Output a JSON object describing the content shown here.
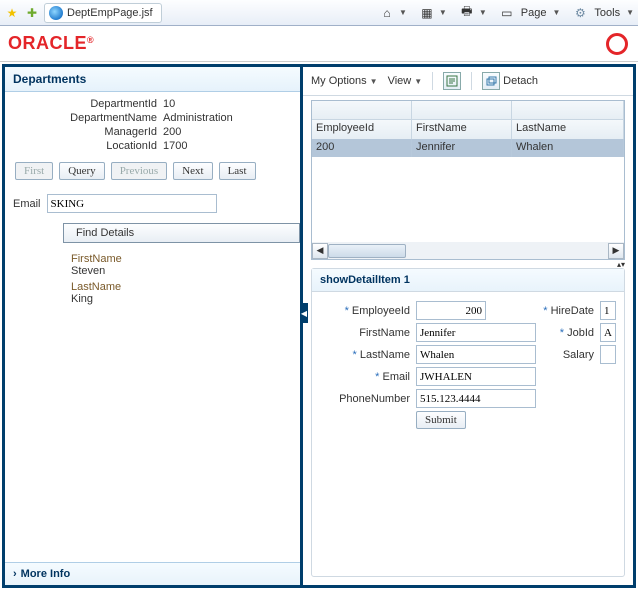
{
  "browser": {
    "star": "★",
    "addstar": "✚",
    "tabIcon": "ie",
    "tabTitle": "DeptEmpPage.jsf",
    "home": "⌂",
    "rss": "▦",
    "print": "🖶",
    "pagebtn": "▭",
    "page": "Page",
    "tools": "Tools",
    "gear": "⚙"
  },
  "oracle": {
    "logo": "ORACLE",
    "reg": "®"
  },
  "dept": {
    "title": "Departments",
    "fields": {
      "deptId_lbl": "DepartmentId",
      "deptId_val": "10",
      "deptName_lbl": "DepartmentName",
      "deptName_val": "Administration",
      "mgrId_lbl": "ManagerId",
      "mgrId_val": "200",
      "locId_lbl": "LocationId",
      "locId_val": "1700"
    },
    "nav": {
      "first": "First",
      "query": "Query",
      "previous": "Previous",
      "next": "Next",
      "last": "Last"
    },
    "email_lbl": "Email",
    "email_val": "SKING",
    "find_details": "Find Details",
    "fn_k": "FirstName",
    "fn_v": "Steven",
    "ln_k": "LastName",
    "ln_v": "King",
    "moreinfo": "More Info"
  },
  "right": {
    "toolbar": {
      "myoptions": "My Options",
      "view": "View",
      "detach": "Detach"
    },
    "grid": {
      "headers": {
        "c1": "EmployeeId",
        "c2": "FirstName",
        "c3": "LastName"
      },
      "row": {
        "c1": "200",
        "c2": "Jennifer",
        "c3": "Whalen"
      }
    },
    "detail": {
      "title": "showDetailItem 1",
      "empId_lbl": "EmployeeId",
      "empId_val": "200",
      "hire_lbl": "HireDate",
      "hire_val": "1",
      "firstName_lbl": "FirstName",
      "firstName_val": "Jennifer",
      "jobId_lbl": "JobId",
      "jobId_val": "A",
      "lastName_lbl": "LastName",
      "lastName_val": "Whalen",
      "salary_lbl": "Salary",
      "salary_val": "",
      "email_lbl": "Email",
      "email_val": "JWHALEN",
      "phone_lbl": "PhoneNumber",
      "phone_val": "515.123.4444",
      "submit": "Submit"
    }
  }
}
